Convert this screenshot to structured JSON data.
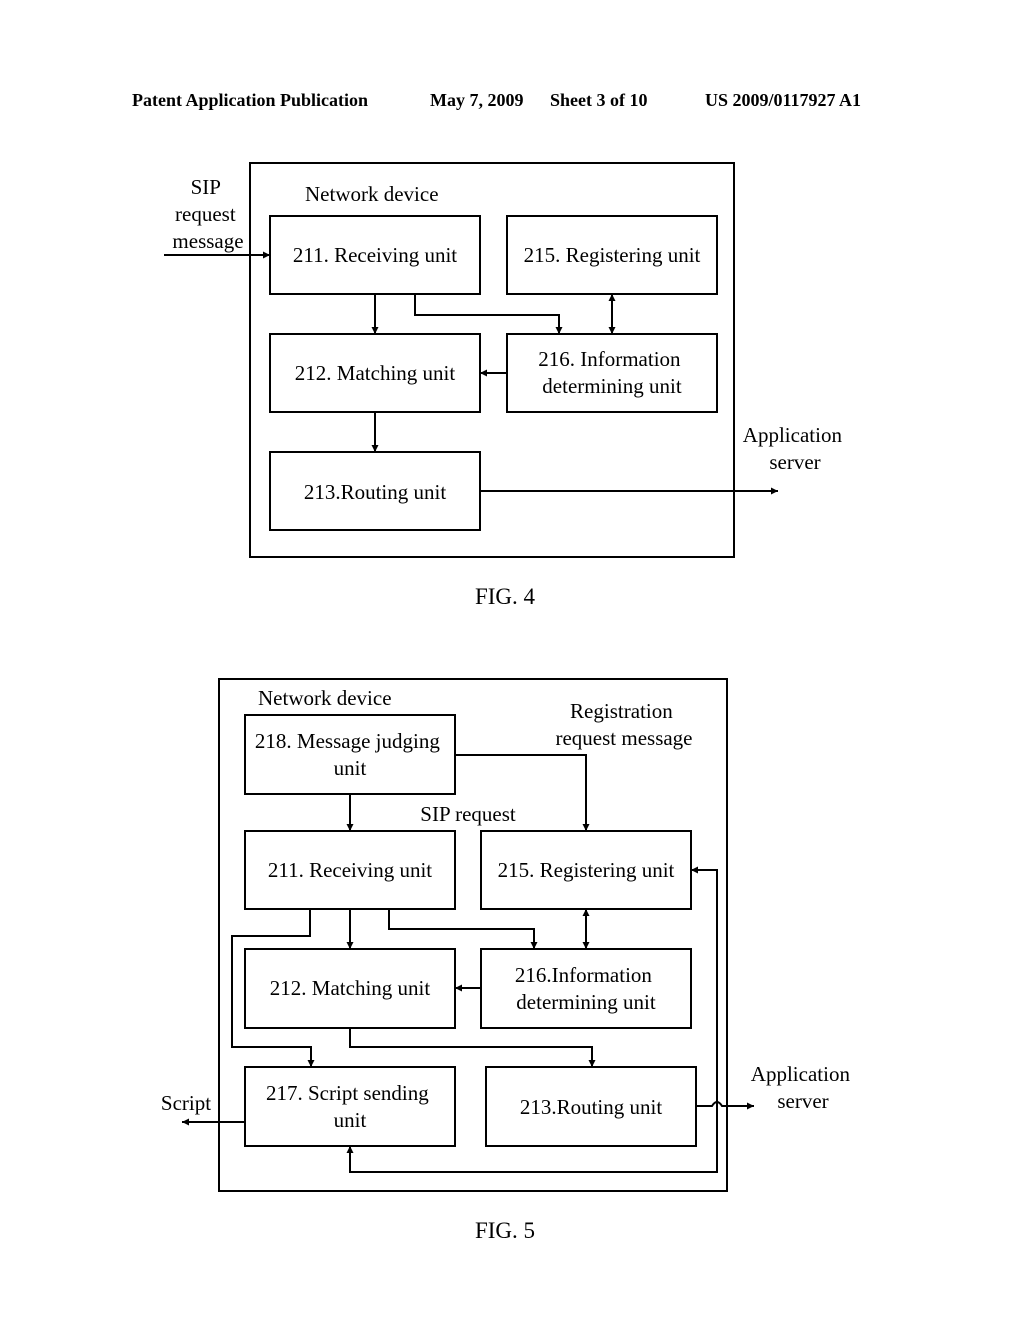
{
  "header": {
    "publication": "Patent Application Publication",
    "date": "May 7, 2009",
    "sheet": "Sheet 3 of 10",
    "number": "US 2009/0117927 A1"
  },
  "fig4": {
    "caption": "FIG. 4",
    "container_label": "Network device",
    "input_label": [
      "SIP",
      "request",
      "message"
    ],
    "output_label": [
      "Application",
      "server"
    ],
    "units": {
      "u211": [
        "211. Receiving unit"
      ],
      "u215": [
        "215. Registering unit"
      ],
      "u212": [
        "212. Matching unit"
      ],
      "u216": [
        "216. Information",
        "determining unit"
      ],
      "u213": [
        "213.Routing unit"
      ]
    }
  },
  "fig5": {
    "caption": "FIG. 5",
    "container_label": "Network device",
    "registration_label": [
      "Registration",
      "request message"
    ],
    "sip_label": "SIP request",
    "script_label": "Script",
    "output_label": [
      "Application",
      "server"
    ],
    "units": {
      "u218": [
        "218. Message judging",
        "unit"
      ],
      "u211": [
        "211. Receiving unit"
      ],
      "u215": [
        "215. Registering unit"
      ],
      "u212": [
        "212. Matching unit"
      ],
      "u216": [
        "216.Information",
        "determining unit"
      ],
      "u217": [
        "217. Script sending",
        "unit"
      ],
      "u213": [
        "213.Routing unit"
      ]
    }
  }
}
